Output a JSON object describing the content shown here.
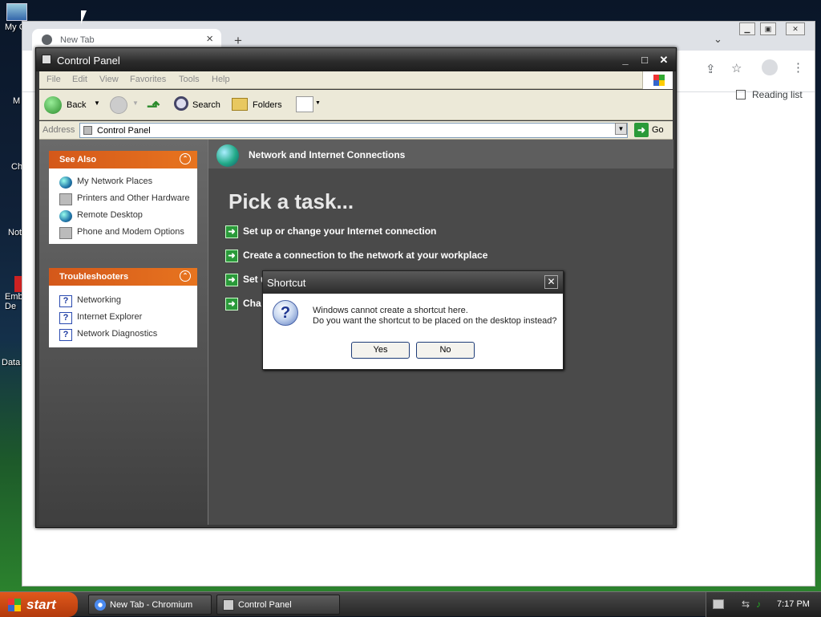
{
  "desktop": {
    "icons": [
      {
        "label": "My C",
        "name": "my-computer"
      },
      {
        "label": "M",
        "name": "my-documents"
      },
      {
        "label": "Ch",
        "name": "chromium"
      },
      {
        "label": "Not",
        "name": "notepad"
      },
      {
        "label": "Emb De",
        "name": "embedded-devices"
      },
      {
        "label": "Data",
        "name": "data"
      }
    ]
  },
  "chromium": {
    "tab_title": "New Tab",
    "reading_list": "Reading list"
  },
  "control_panel": {
    "title": "Control Panel",
    "menu": [
      "File",
      "Edit",
      "View",
      "Favorites",
      "Tools",
      "Help"
    ],
    "toolbar": {
      "back": "Back",
      "search": "Search",
      "folders": "Folders"
    },
    "address_label": "Address",
    "address_value": "Control Panel",
    "go": "Go",
    "see_also": {
      "title": "See Also",
      "items": [
        "My Network Places",
        "Printers and Other Hardware",
        "Remote Desktop",
        "Phone and Modem Options"
      ]
    },
    "troubleshooters": {
      "title": "Troubleshooters",
      "items": [
        "Networking",
        "Internet Explorer",
        "Network Diagnostics"
      ]
    },
    "category_title": "Network and Internet Connections",
    "pick_task": "Pick a task...",
    "tasks": [
      "Set up or change your Internet connection",
      "Create a connection to the network at your workplace",
      "Set u",
      "Cha"
    ]
  },
  "dialog": {
    "title": "Shortcut",
    "line1": "Windows cannot create a shortcut here.",
    "line2": "Do you want the shortcut to be placed on the desktop instead?",
    "yes": "Yes",
    "no": "No"
  },
  "taskbar": {
    "start": "start",
    "buttons": [
      "New Tab - Chromium",
      "Control Panel"
    ],
    "clock": "7:17 PM"
  }
}
